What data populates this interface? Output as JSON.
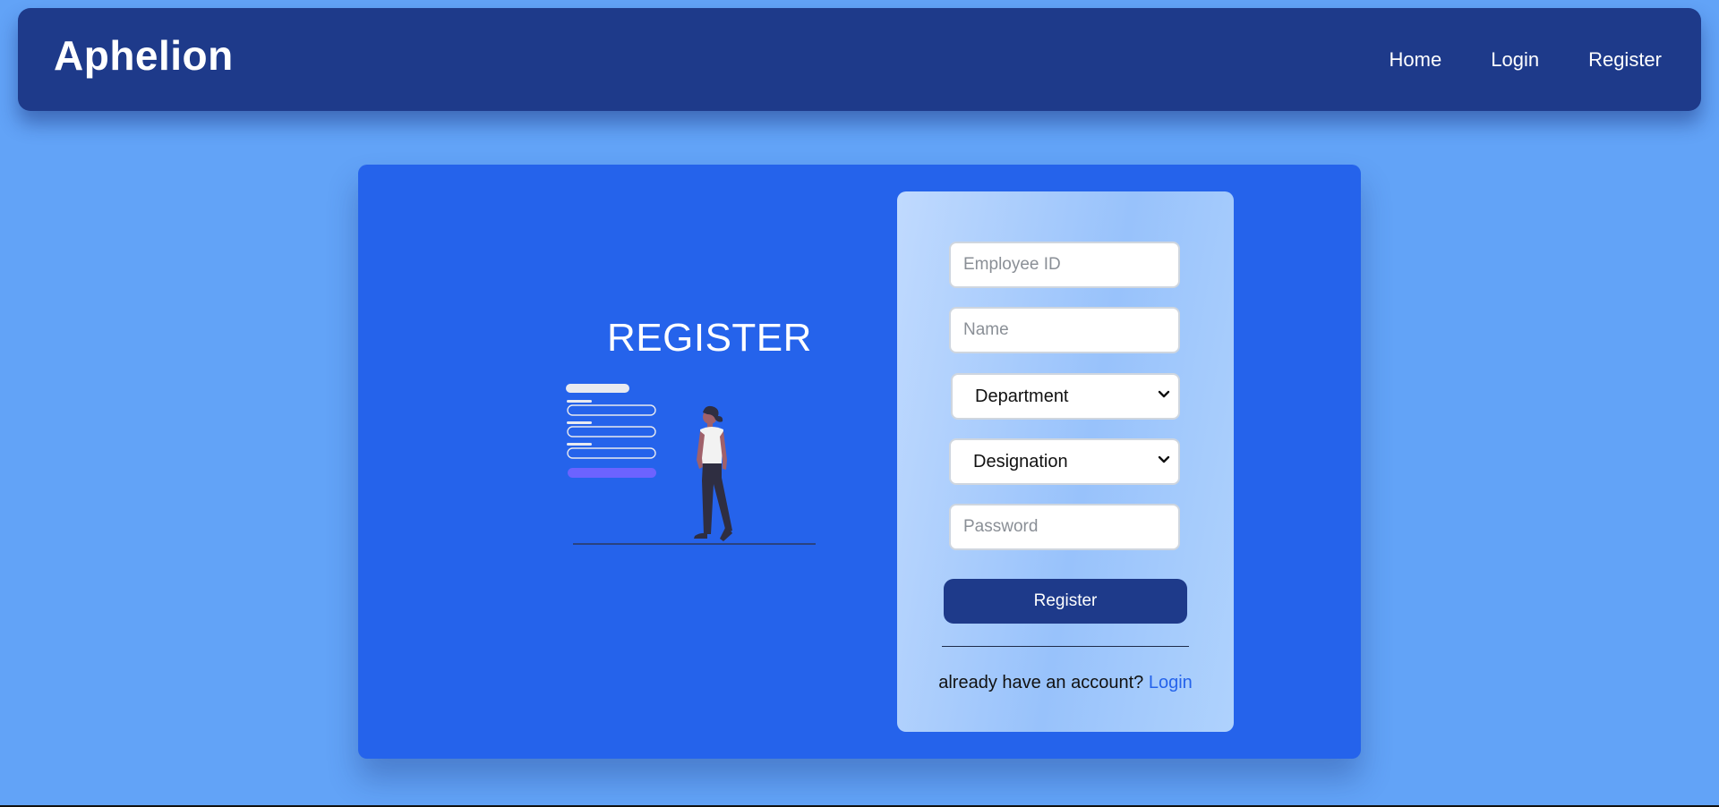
{
  "app": {
    "brand": "Aphelion"
  },
  "nav": {
    "links": [
      {
        "label": "Home"
      },
      {
        "label": "Login"
      },
      {
        "label": "Register"
      }
    ]
  },
  "hero": {
    "title": "REGISTER"
  },
  "form": {
    "employee_id": {
      "placeholder": "Employee ID",
      "value": ""
    },
    "name": {
      "placeholder": "Name",
      "value": ""
    },
    "department": {
      "selected": "Department"
    },
    "designation": {
      "selected": "Designation"
    },
    "password": {
      "placeholder": "Password",
      "value": ""
    },
    "submit_label": "Register",
    "switch_prompt": "already have an account? ",
    "switch_link": "Login"
  },
  "colors": {
    "page_bg": "#62a3f7",
    "navbar_bg": "#1e3a8a",
    "card_bg": "#2563eb",
    "accent": "#6c63ff",
    "button_bg": "#1e3a8a",
    "link": "#2563eb"
  },
  "icons": {
    "select_arrow": "chevron-down-icon",
    "illustration": "register-form-illustration"
  }
}
